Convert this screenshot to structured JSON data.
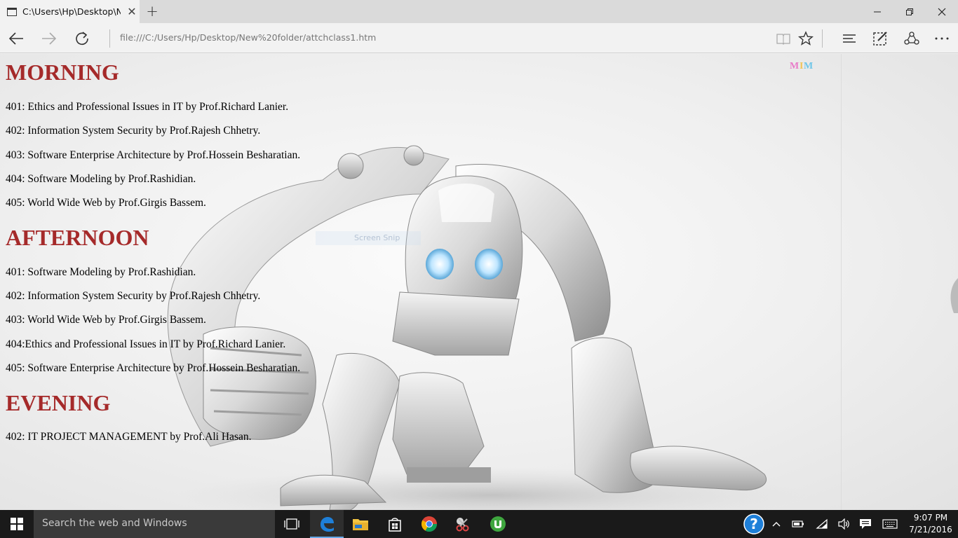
{
  "browser": {
    "tab_title": "C:\\Users\\Hp\\Desktop\\N",
    "address": "file:///C:/Users/Hp/Desktop/New%20folder/attchclass1.htm"
  },
  "page": {
    "logo_text": "MIM",
    "overlay_text": "Screen Snip",
    "sections": [
      {
        "title": "MORNING",
        "courses": [
          "401: Ethics and Professional Issues in IT by Prof.Richard Lanier.",
          "402: Information System Security by Prof.Rajesh Chhetry.",
          "403: Software Enterprise Architecture by Prof.Hossein Besharatian.",
          "404: Software Modeling by Prof.Rashidian.",
          "405: World Wide Web by Prof.Girgis Bassem."
        ]
      },
      {
        "title": "AFTERNOON",
        "courses": [
          "401: Software Modeling by Prof.Rashidian.",
          "402: Information System Security by Prof.Rajesh Chhetry.",
          "403: World Wide Web by Prof.Girgis Bassem.",
          "404:Ethics and Professional Issues in IT by Prof.Richard Lanier.",
          "405: Software Enterprise Architecture by Prof.Hossein Besharatian."
        ]
      },
      {
        "title": "EVENING",
        "courses": [
          "402: IT PROJECT MANAGEMENT by Prof.Ali Hasan."
        ]
      }
    ]
  },
  "taskbar": {
    "search_placeholder": "Search the web and Windows",
    "time": "9:07 PM",
    "date": "7/21/2016"
  },
  "colors": {
    "heading": "#a52a2a",
    "edge_blue": "#1e7fd8",
    "taskbar": "#1a1a1a"
  }
}
